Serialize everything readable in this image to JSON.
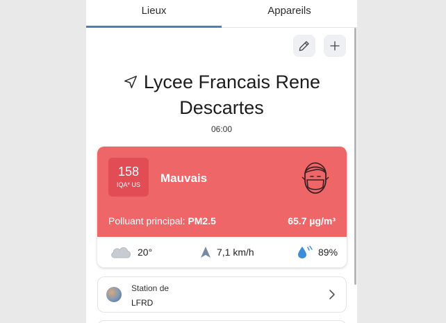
{
  "tabs": [
    {
      "label": "Lieux",
      "active": true
    },
    {
      "label": "Appareils",
      "active": false
    }
  ],
  "toolbar": {
    "edit_icon": "pencil-icon",
    "add_icon": "plus-icon"
  },
  "location": {
    "nav_icon": "navigation-arrow-icon",
    "name": "Lycee Francais Rene Descartes",
    "time": "06:00"
  },
  "aqi": {
    "value": "158",
    "unit": "IQA* US",
    "status": "Mauvais",
    "pollutant_label": "Polluant principal:",
    "pollutant": "PM2.5",
    "concentration": "65.7 µg/m³",
    "status_color": "#ee6667",
    "face_icon": "mask-face-icon"
  },
  "weather": {
    "temperature": "20°",
    "temperature_icon": "cloud-icon",
    "wind": "7,1 km/h",
    "wind_icon": "wind-direction-icon",
    "humidity": "89%",
    "humidity_icon": "humidity-drop-icon"
  },
  "station": {
    "label": "Station de",
    "name": "LFRD"
  },
  "colors": {
    "accent": "#4a7fb8",
    "aqi_bad": "#ee6667",
    "aqi_box": "#e04d55"
  }
}
